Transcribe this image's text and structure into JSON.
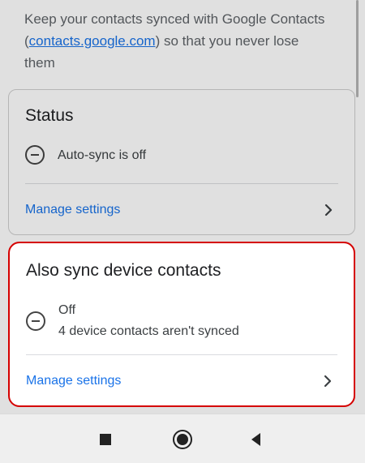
{
  "intro": {
    "text_before": "Keep your contacts synced with Google Contacts (",
    "link": "contacts.google.com",
    "text_after": ") so that you never lose them"
  },
  "status_card": {
    "title": "Status",
    "autosync_text": "Auto-sync is off",
    "manage_label": "Manage settings"
  },
  "device_card": {
    "title": "Also sync device contacts",
    "state": "Off",
    "detail": "4 device contacts aren't synced",
    "manage_label": "Manage settings"
  },
  "colors": {
    "link": "#1a73e8",
    "highlight_border": "#d50000"
  },
  "icons": {
    "status_row": "minus-circle-icon",
    "manage": "chevron-right-icon",
    "nav": [
      "recents-square-icon",
      "home-circle-icon",
      "back-triangle-icon"
    ]
  }
}
